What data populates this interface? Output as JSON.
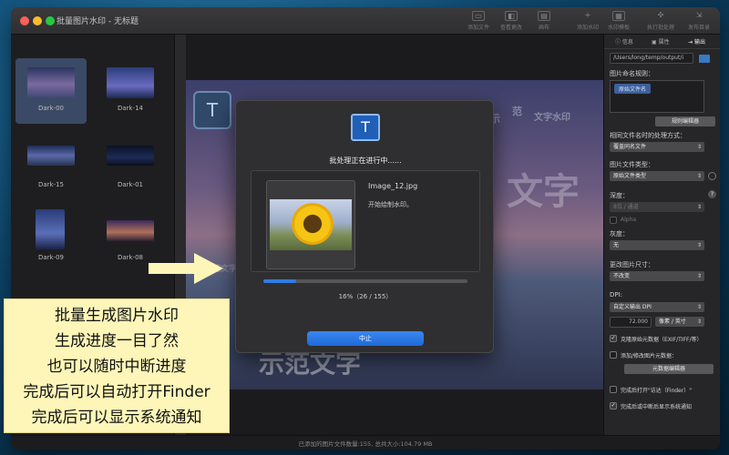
{
  "window": {
    "title": "批量图片水印 - 无标题"
  },
  "toolbar": {
    "items": [
      "添加文件",
      "查看更改",
      "画布",
      "添加水印",
      "水印模板",
      "执行批处理",
      "发布目录"
    ]
  },
  "sidebar": {
    "items": [
      {
        "label": "Dark-00",
        "selected": true
      },
      {
        "label": "Dark-14",
        "selected": false
      },
      {
        "label": "Dark-15",
        "selected": false
      },
      {
        "label": "Dark-01",
        "selected": false
      },
      {
        "label": "Dark-09",
        "selected": false
      },
      {
        "label": "Dark-08",
        "selected": false
      }
    ]
  },
  "canvas": {
    "watermark_texts": [
      "示",
      "范",
      "文字水印",
      "文字",
      "示范文字",
      "示范文字"
    ]
  },
  "dialog": {
    "title": "批处理正在进行中......",
    "file_name": "Image_12.jpg",
    "file_status": "开始绘制水印。",
    "progress_text": "16%（26 / 155）",
    "progress_fraction": 0.16,
    "stop_label": "中止"
  },
  "panel": {
    "tabs": [
      "信息",
      "属性",
      "输出"
    ],
    "output_path": "/Users/long/temp/output/i",
    "naming_rule_label": "图片命名规则：",
    "naming_token": "原始文件名",
    "rule_editor_button": "规则编辑器",
    "same_name_label": "相同文件名时的处理方式：",
    "same_name_value": "覆盖同名文件",
    "file_type_label": "图片文件类型：",
    "file_type_value": "原始文件类型",
    "depth_label": "深度：",
    "depth_value": "8位 / 通道",
    "alpha_label": "Alpha",
    "grayscale_label": "灰度：",
    "grayscale_value": "无",
    "size_label": "更改图片尺寸：",
    "size_value": "不改变",
    "dpi_label": "DPI:",
    "dpi_value": "自定义输出 DPI",
    "dpi_number": "72.000",
    "dpi_unit": "像素 / 英寸",
    "clone_meta_label": "克隆原始元数据（EXIF/TIFF/等）",
    "edit_meta_label": "添加/修改图片元数据：",
    "meta_editor_button": "元数据编辑器",
    "open_finder_label": "完成后打开\"访达（Finder）\"",
    "notify_label": "完成后或中断后显示系统通知"
  },
  "status": {
    "text": "已添加的图片文件数量:155, 总共大小:104.79 MB"
  },
  "callout": {
    "lines": [
      "批量生成图片水印",
      "生成进度一目了然",
      "也可以随时中断进度",
      "完成后可以自动打开Finder",
      "完成后可以显示系统通知"
    ]
  },
  "colors": {
    "accent": "#2f7be8",
    "callout_bg": "#fdf6b8"
  }
}
